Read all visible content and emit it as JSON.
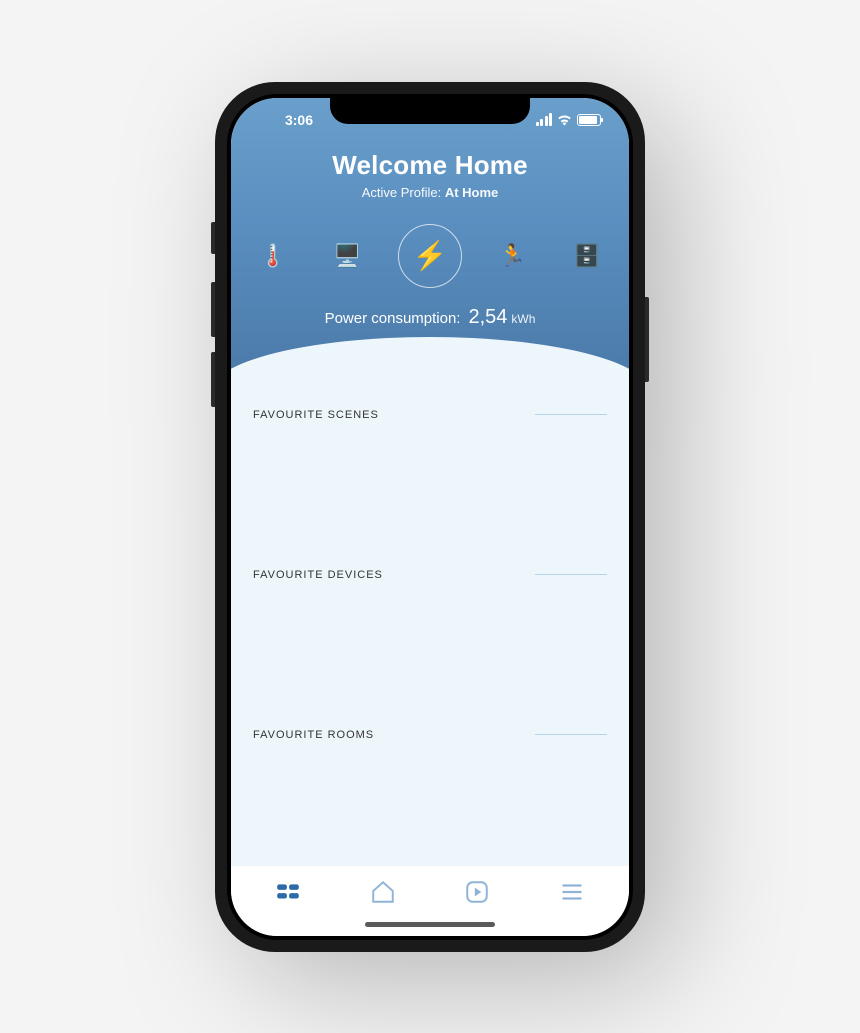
{
  "status": {
    "time": "3:06"
  },
  "header": {
    "title": "Welcome Home",
    "profile_label": "Active Profile:",
    "profile_value": "At Home"
  },
  "power": {
    "label": "Power consumption:",
    "value": "2,54",
    "unit": "kWh"
  },
  "quick_actions": [
    {
      "name": "thermometer",
      "glyph": "🌡️"
    },
    {
      "name": "oven",
      "glyph": "🖥️"
    },
    {
      "name": "power",
      "glyph": "⚡"
    },
    {
      "name": "motion",
      "glyph": "🏃"
    },
    {
      "name": "fridge",
      "glyph": "🗄️"
    }
  ],
  "sections": [
    {
      "title": "FAVOURITE SCENES"
    },
    {
      "title": "FAVOURITE DEVICES"
    },
    {
      "title": "FAVOURITE ROOMS"
    }
  ],
  "tabs": [
    {
      "name": "dashboard",
      "active": true
    },
    {
      "name": "home",
      "active": false
    },
    {
      "name": "scenes",
      "active": false
    },
    {
      "name": "menu",
      "active": false
    }
  ]
}
